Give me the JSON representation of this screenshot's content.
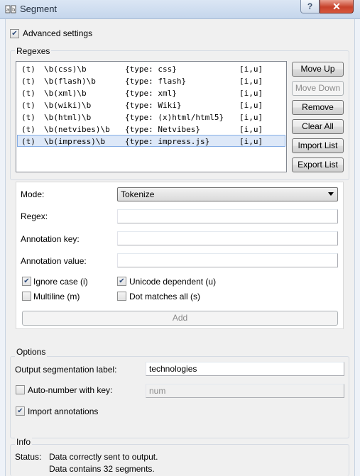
{
  "window": {
    "title": "Segment",
    "help_label": "?",
    "close_label": "✕"
  },
  "advanced_settings": {
    "label": "Advanced settings",
    "checked": true
  },
  "regexes": {
    "group_title": "Regexes",
    "rows": [
      {
        "t": "(t)",
        "regex": "\\b(css)\\b",
        "type": "{type: css}",
        "flags": "[i,u]"
      },
      {
        "t": "(t)",
        "regex": "\\b(flash)\\b",
        "type": "{type: flash}",
        "flags": "[i,u]"
      },
      {
        "t": "(t)",
        "regex": "\\b(xml)\\b",
        "type": "{type: xml}",
        "flags": "[i,u]"
      },
      {
        "t": "(t)",
        "regex": "\\b(wiki)\\b",
        "type": "{type: Wiki}",
        "flags": "[i,u]"
      },
      {
        "t": "(t)",
        "regex": "\\b(html)\\b",
        "type": "{type: (x)html/html5}",
        "flags": "[i,u]"
      },
      {
        "t": "(t)",
        "regex": "\\b(netvibes)\\b",
        "type": "{type: Netvibes}",
        "flags": "[i,u]"
      },
      {
        "t": "(t)",
        "regex": "\\b(impress)\\b",
        "type": "{type: impress.js}",
        "flags": "[i,u]"
      }
    ],
    "selected_index": 6,
    "buttons": {
      "move_up": "Move Up",
      "move_down": "Move Down",
      "remove": "Remove",
      "clear_all": "Clear All",
      "import_list": "Import List",
      "export_list": "Export List"
    }
  },
  "editor": {
    "mode_label": "Mode:",
    "mode_value": "Tokenize",
    "regex_label": "Regex:",
    "regex_value": "",
    "annotation_key_label": "Annotation key:",
    "annotation_key_value": "",
    "annotation_value_label": "Annotation value:",
    "annotation_value_value": "",
    "ignore_case": {
      "label": "Ignore case (i)",
      "checked": true
    },
    "unicode_dependent": {
      "label": "Unicode dependent (u)",
      "checked": true
    },
    "multiline": {
      "label": "Multiline (m)",
      "checked": false
    },
    "dot_matches_all": {
      "label": "Dot matches all (s)",
      "checked": false
    },
    "add_button": "Add"
  },
  "options": {
    "group_title": "Options",
    "output_label": "Output segmentation label:",
    "output_value": "technologies",
    "auto_number": {
      "label": "Auto-number with key:",
      "checked": false
    },
    "auto_number_value": "num",
    "import_annotations": {
      "label": "Import annotations",
      "checked": true
    }
  },
  "info": {
    "group_title": "Info",
    "status_label": "Status:",
    "status_line1": "Data correctly sent to output.",
    "status_line2": "Data contains 32 segments."
  }
}
